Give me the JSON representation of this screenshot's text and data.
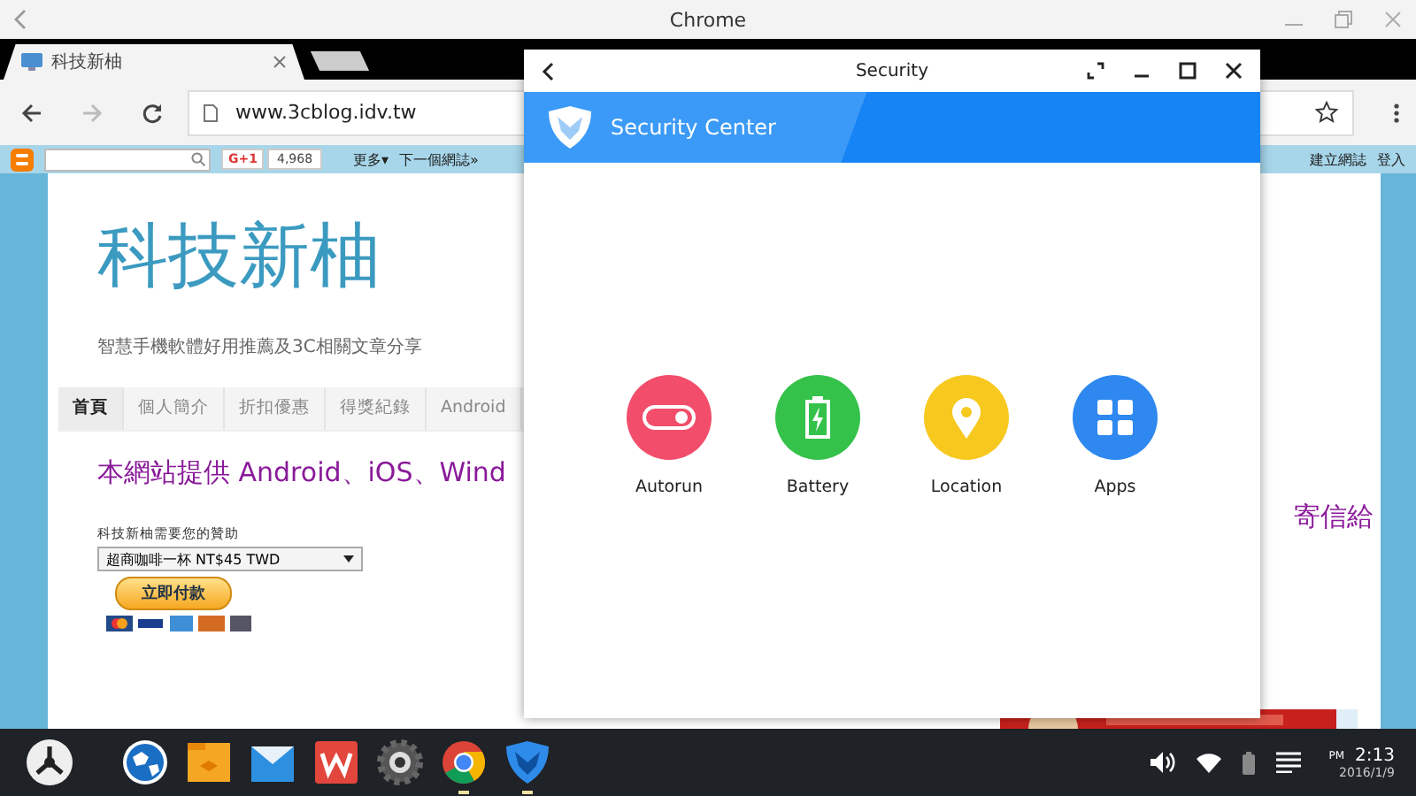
{
  "chrome_window": {
    "title": "Chrome"
  },
  "tab": {
    "title": "科技新柚",
    "selected": true
  },
  "address": "www.3cblog.idv.tw",
  "blogger_bar": {
    "plus_one": "G+1",
    "count": "4,968",
    "more": "更多▾",
    "next_blog": "下一個網誌»",
    "create_blog": "建立網誌",
    "sign_in": "登入"
  },
  "blog": {
    "title": "科技新柚",
    "subtitle": "智慧手機軟體好用推薦及3C相關文章分享",
    "nav": [
      {
        "label": "首頁",
        "selected": true
      },
      {
        "label": "個人簡介",
        "selected": false
      },
      {
        "label": "折扣優惠",
        "selected": false
      },
      {
        "label": "得獎紀錄",
        "selected": false
      },
      {
        "label": "Android",
        "selected": false
      }
    ],
    "headline": "本網站提供 Android、iOS、Wind",
    "headline_end": "寄信給",
    "donate_label": "科技新柚需要您的贊助",
    "donate_option": "超商咖啡一杯 NT$45 TWD",
    "pay_button": "立即付款"
  },
  "security": {
    "title": "Security",
    "header": "Security Center",
    "features": [
      {
        "label": "Autorun",
        "kind": "toggle",
        "color": "#f24e6b"
      },
      {
        "label": "Battery",
        "kind": "battery",
        "color": "#35c24a"
      },
      {
        "label": "Location",
        "kind": "pin",
        "color": "#f7c81e"
      },
      {
        "label": "Apps",
        "kind": "grid",
        "color": "#2e88ef"
      }
    ]
  },
  "taskbar": {
    "apps": [
      {
        "kind": "globe",
        "running": false
      },
      {
        "kind": "files",
        "running": false
      },
      {
        "kind": "mail",
        "running": false
      },
      {
        "kind": "office",
        "running": false
      },
      {
        "kind": "camera",
        "running": false
      },
      {
        "kind": "chrome",
        "running": true
      },
      {
        "kind": "shield",
        "running": true
      }
    ],
    "ampm": "PM",
    "time": "2:13",
    "date": "2016/1/9"
  }
}
